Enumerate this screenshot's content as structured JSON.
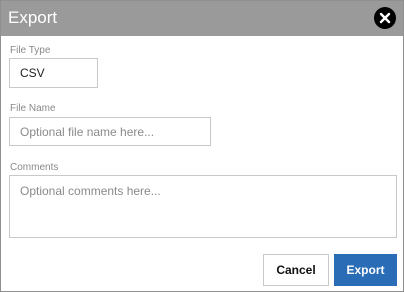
{
  "dialog": {
    "title": "Export",
    "close_icon": "close-circle-icon"
  },
  "file_type": {
    "label": "File Type",
    "value": "CSV"
  },
  "file_name": {
    "label": "File Name",
    "value": "",
    "placeholder": "Optional file name here..."
  },
  "comments": {
    "label": "Comments",
    "value": "",
    "placeholder": "Optional comments here..."
  },
  "buttons": {
    "cancel": "Cancel",
    "export": "Export"
  },
  "colors": {
    "titlebar": "#9a9a9a",
    "primary": "#2a6db6"
  }
}
